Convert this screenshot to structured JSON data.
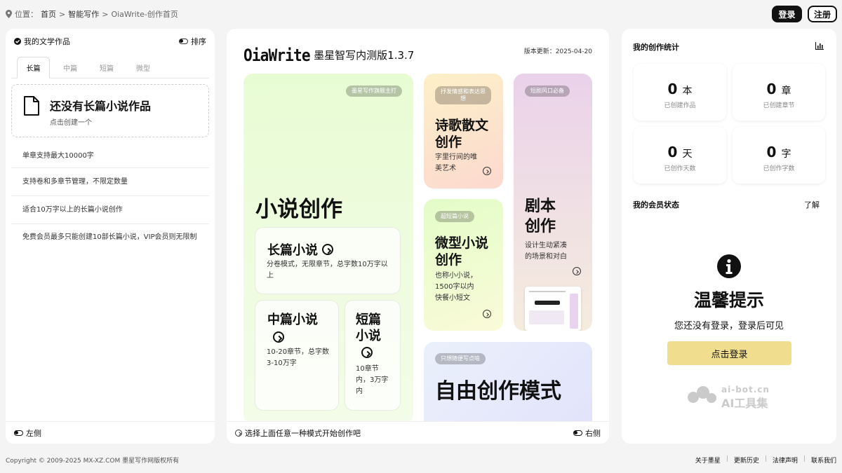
{
  "breadcrumb": {
    "label": "位置：",
    "items": [
      "首页",
      "智能写作",
      "OiaWrite-创作首页"
    ],
    "sep": ">"
  },
  "auth": {
    "login": "登录",
    "register": "注册"
  },
  "left": {
    "title": "我的文学作品",
    "sort": "排序",
    "tabs": [
      "长篇",
      "中篇",
      "短篇",
      "微型"
    ],
    "empty_title": "还没有长篇小说作品",
    "empty_sub": "点击创建一个",
    "features": [
      "单章支持最大10000字",
      "支持卷和多章节管理，不限定数量",
      "适合10万字以上的长篇小说创作",
      "免费会员最多只能创建10部长篇小说，VIP会员则无限制"
    ],
    "bottom": "左侧"
  },
  "center": {
    "logo": "OiaWrite",
    "subtitle": "- 墨星智写内测版1.3.7",
    "version": "版本更新：2025-04-20",
    "novel": {
      "pill": "墨星写作旗舰主打",
      "title": "小说创作",
      "long_title": "长篇小说",
      "long_desc": "分卷模式，无限章节，总字数10万字以上",
      "mid_title": "中篇小说",
      "mid_desc": "10-20章节，总字数3-10万字",
      "short_title": "短篇小说",
      "short_desc": "10章节内，3万字内"
    },
    "poetry": {
      "pill": "抒发情感和表达思想",
      "title": "诗歌散文创作",
      "desc": "字里行间的唯美艺术"
    },
    "micro": {
      "pill": "超短篇小说",
      "title": "微型小说创作",
      "desc": "也称小小说，1500字以内快餐小短文"
    },
    "script": {
      "pill": "短剧风口必备",
      "title": "剧本创作",
      "desc": "设计生动紧凑的场景和对白"
    },
    "free": {
      "pill": "只想随便写点啥",
      "title": "自由创作模式"
    },
    "bottom": "选择上面任意一种模式开始创作吧",
    "bottom_right": "右侧"
  },
  "right": {
    "stats_title": "我的创作统计",
    "stats": [
      {
        "num": "0",
        "unit": "本",
        "label": "已创建作品"
      },
      {
        "num": "0",
        "unit": "章",
        "label": "已创建章节"
      },
      {
        "num": "0",
        "unit": "天",
        "label": "已创作天数"
      },
      {
        "num": "0",
        "unit": "字",
        "label": "已创作字数"
      }
    ],
    "member_title": "我的会员状态",
    "member_link": "了解",
    "tip_title": "温馨提示",
    "tip_text": "您还没有登录，登录后可见",
    "tip_button": "点击登录",
    "watermark_top": "ai-bot.cn",
    "watermark_bottom": "AI工具集"
  },
  "footer": {
    "copyright": "Copyright © 2009-2025 MX-XZ.COM 墨星写作网版权所有",
    "links": [
      "关于墨星",
      "更新历史",
      "法律声明",
      "联系我们"
    ]
  },
  "colors": {
    "login_btn": "#f1dd8e",
    "novel_bg": "#e9fbd6",
    "poetry_bg": "#fde3cf",
    "micro_bg": "#f1fbd8",
    "script_bg": "#ead8ea",
    "free_bg": "#e4e6fb"
  }
}
